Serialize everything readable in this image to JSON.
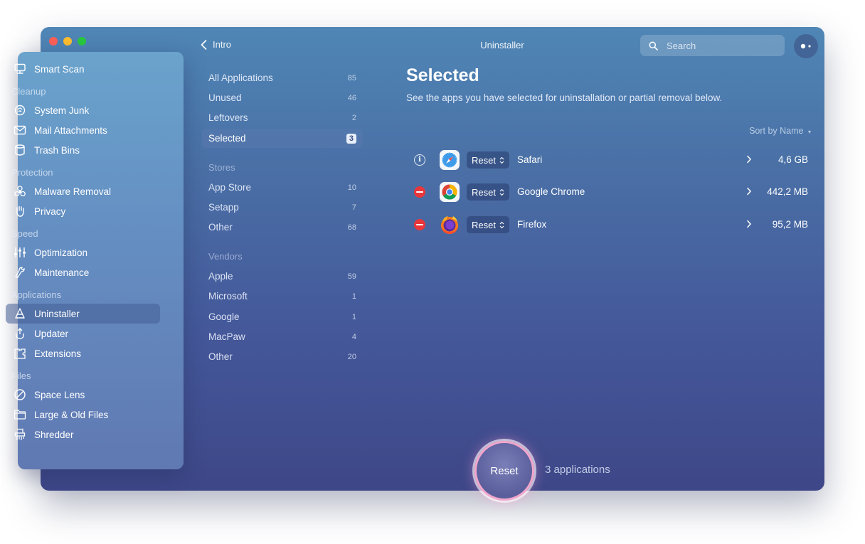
{
  "titlebar": {
    "back_label": "Intro",
    "title": "Uninstaller",
    "search_placeholder": "Search"
  },
  "sidebar": {
    "smart_scan": "Smart Scan",
    "sections": [
      {
        "header": "Cleanup",
        "items": [
          {
            "label": "System Junk",
            "icon": "system-junk-icon"
          },
          {
            "label": "Mail Attachments",
            "icon": "mail-icon"
          },
          {
            "label": "Trash Bins",
            "icon": "trash-icon"
          }
        ]
      },
      {
        "header": "Protection",
        "items": [
          {
            "label": "Malware Removal",
            "icon": "biohazard-icon"
          },
          {
            "label": "Privacy",
            "icon": "hand-icon"
          }
        ]
      },
      {
        "header": "Speed",
        "items": [
          {
            "label": "Optimization",
            "icon": "sliders-icon"
          },
          {
            "label": "Maintenance",
            "icon": "wrench-icon"
          }
        ]
      },
      {
        "header": "Applications",
        "items": [
          {
            "label": "Uninstaller",
            "icon": "uninstaller-icon",
            "active": true
          },
          {
            "label": "Updater",
            "icon": "updater-icon"
          },
          {
            "label": "Extensions",
            "icon": "extensions-icon"
          }
        ]
      },
      {
        "header": "Files",
        "items": [
          {
            "label": "Space Lens",
            "icon": "space-lens-icon"
          },
          {
            "label": "Large & Old Files",
            "icon": "folder-icon"
          },
          {
            "label": "Shredder",
            "icon": "shredder-icon"
          }
        ]
      }
    ]
  },
  "categories": {
    "main": [
      {
        "label": "All Applications",
        "count": "85"
      },
      {
        "label": "Unused",
        "count": "46"
      },
      {
        "label": "Leftovers",
        "count": "2"
      },
      {
        "label": "Selected",
        "count": "3",
        "active": true
      }
    ],
    "stores_header": "Stores",
    "stores": [
      {
        "label": "App Store",
        "count": "10"
      },
      {
        "label": "Setapp",
        "count": "7"
      },
      {
        "label": "Other",
        "count": "68"
      }
    ],
    "vendors_header": "Vendors",
    "vendors": [
      {
        "label": "Apple",
        "count": "59"
      },
      {
        "label": "Microsoft",
        "count": "1"
      },
      {
        "label": "Google",
        "count": "1"
      },
      {
        "label": "MacPaw",
        "count": "4"
      },
      {
        "label": "Other",
        "count": "20"
      }
    ]
  },
  "main": {
    "title": "Selected",
    "subtitle": "See the apps you have selected for uninstallation or partial removal below.",
    "sort_label": "Sort by Name",
    "apps": [
      {
        "name": "Safari",
        "size": "4,6 GB",
        "action": "Reset",
        "state": "info",
        "icon": "safari-icon"
      },
      {
        "name": "Google Chrome",
        "size": "442,2 MB",
        "action": "Reset",
        "state": "remove",
        "icon": "chrome-icon"
      },
      {
        "name": "Firefox",
        "size": "95,2 MB",
        "action": "Reset",
        "state": "remove",
        "icon": "firefox-icon"
      }
    ]
  },
  "footer": {
    "reset_label": "Reset",
    "count_label": "3 applications"
  },
  "colors": {
    "remove": "#e8363b",
    "reset_ring": "#f2a6cc"
  }
}
